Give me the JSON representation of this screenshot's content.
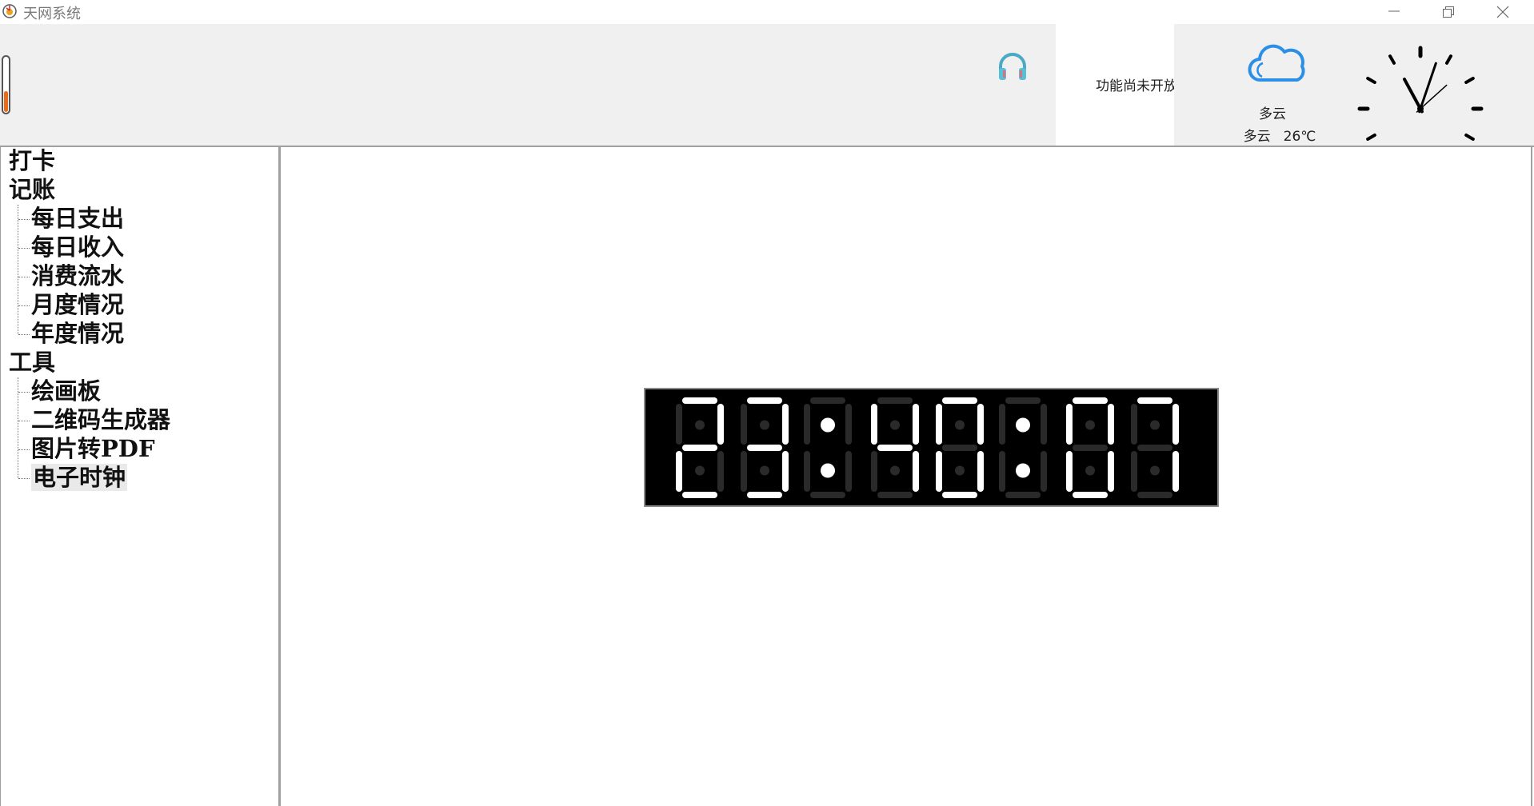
{
  "window": {
    "title": "天网系统",
    "app_icon": "app-logo-icon",
    "controls": [
      "minimize-icon",
      "restore-icon",
      "close-icon"
    ]
  },
  "toolbar": {
    "thermometer_level": 0.4,
    "music_icon": "headphone-icon",
    "notice": "功能尚未开放",
    "weather": {
      "icon": "cloud-icon",
      "condition": "多云",
      "detail_condition": "多云",
      "temperature": "26℃"
    },
    "analog_clock": {
      "hour": 11,
      "minute": 3,
      "second": 8
    }
  },
  "tree": {
    "items": [
      {
        "label": "打卡",
        "level": 0
      },
      {
        "label": "记账",
        "level": 0
      },
      {
        "label": "每日支出",
        "level": 1
      },
      {
        "label": "每日收入",
        "level": 1
      },
      {
        "label": "消费流水",
        "level": 1
      },
      {
        "label": "月度情况",
        "level": 1
      },
      {
        "label": "年度情况",
        "level": 1
      },
      {
        "label": "工具",
        "level": 0
      },
      {
        "label": "绘画板",
        "level": 1
      },
      {
        "label": "二维码生成器",
        "level": 1
      },
      {
        "label": "图片转PDF",
        "level": 1
      },
      {
        "label": "电子时钟",
        "level": 1,
        "selected": true
      }
    ]
  },
  "digital_clock": {
    "time": "23:40:07",
    "on_color": "#ffffff",
    "off_color": "#2a2a2a",
    "background": "#000000"
  }
}
